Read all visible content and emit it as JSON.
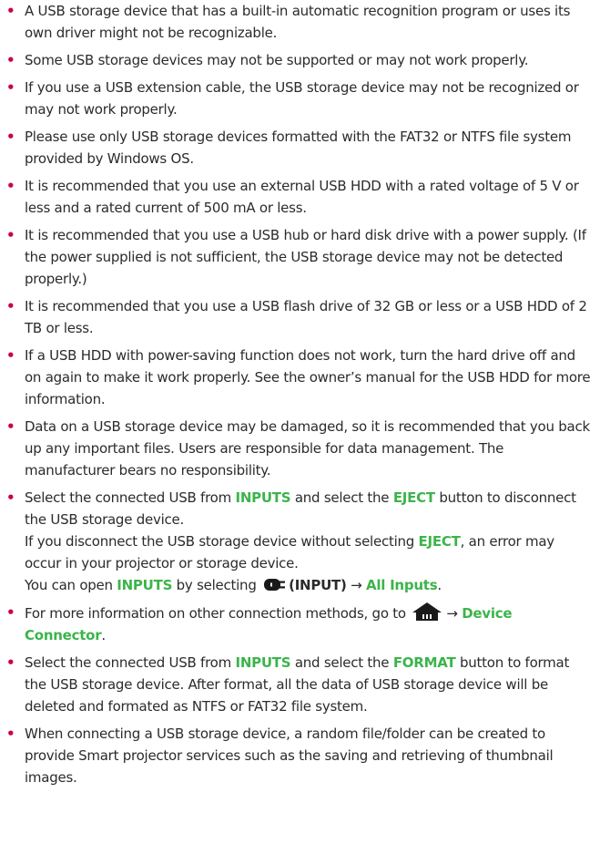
{
  "bullet_glyph": "•",
  "colors": {
    "bullet": "#c8004b",
    "highlight": "#3cb44b",
    "text": "#2b2b2b"
  },
  "icons": {
    "input": "input-plug-icon",
    "home": "home-icon"
  },
  "notes": [
    {
      "text": "A USB storage device that has a built-in automatic recognition program or uses its own driver might not be recognizable."
    },
    {
      "text": "Some USB storage devices may not be supported or may not work properly."
    },
    {
      "text": "If you use a USB extension cable, the USB storage device may not be recognized or may not work properly."
    },
    {
      "text": "Please use only USB storage devices formatted with the FAT32 or NTFS file system provided by Windows OS."
    },
    {
      "text": "It is recommended that you use an external USB HDD with a rated voltage of 5 V or less and a rated current of 500 mA or less."
    },
    {
      "text": "It is recommended that you use a USB hub or hard disk drive with a power supply. (If the power supplied is not sufficient, the USB storage device may not be detected properly.)"
    },
    {
      "text": "It is recommended that you use a USB flash drive of 32 GB or less or a USB HDD of 2 TB or less."
    },
    {
      "text": "If a USB HDD with power-saving function does not work, turn the hard drive off and on again to make it work properly. See the owner’s manual for the USB HDD for more information."
    },
    {
      "text": "Data on a USB storage device may be damaged, so it is recommended that you back up any important files. Users are responsible for data management. The manufacturer bears no responsibility."
    }
  ],
  "eject_note": {
    "p1_a": "Select the connected USB from ",
    "p1_inputs": "INPUTS",
    "p1_b": " and select the ",
    "p1_eject": "EJECT",
    "p1_c": " button to disconnect the USB storage device.",
    "p2_a": "If you disconnect the USB storage device without selecting ",
    "p2_eject": "EJECT",
    "p2_b": ", an error may occur in your projector or storage device.",
    "p3_a": "You can open ",
    "p3_inputs": "INPUTS",
    "p3_b": " by selecting ",
    "p3_input_label": "(INPUT)",
    "p3_arrow": " → ",
    "p3_all_inputs": "All Inputs",
    "p3_end": "."
  },
  "connection_note": {
    "a": "For more information on other connection methods, go to ",
    "arrow": "→ ",
    "device_connector": "Device Connector",
    "end": "."
  },
  "format_note": {
    "a": "Select the connected USB from ",
    "inputs": "INPUTS",
    "b": " and select the ",
    "format": "FORMAT",
    "c": " button to format the USB storage device. After format, all the data of USB storage device will be deleted and formated as NTFS or FAT32 file system."
  },
  "smart_note": {
    "text": "When connecting a USB storage device, a random file/folder can be created to provide Smart projector services such as the saving and retrieving of thumbnail images."
  }
}
